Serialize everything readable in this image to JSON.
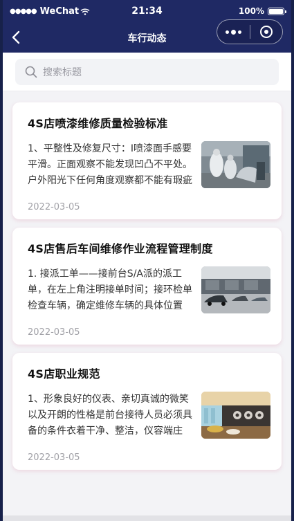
{
  "status_bar": {
    "carrier": "WeChat",
    "time": "21:34",
    "battery": "100%"
  },
  "nav": {
    "title": "车行动态"
  },
  "search": {
    "placeholder": "搜索标题"
  },
  "articles": [
    {
      "title": "4S店喷漆维修质量检验标准",
      "excerpt": "1、平整性及修复尺寸：Ⅰ喷漆面手感要平滑。正面观察不能发现凹凸不平处。户外阳光下任何角度观察都不能有瑕疵",
      "date": "2022-03-05",
      "thumb_icon": "paint-workshop-photo"
    },
    {
      "title": "4S店售后车间维修作业流程管理制度",
      "excerpt": "1. 接派工单——接前台S/A派的派工单，在左上角注明接单时间；接环检单检查车辆，确定维修车辆的具体位置",
      "date": "2022-03-05",
      "thumb_icon": "service-workshop-photo"
    },
    {
      "title": "4S店职业规范",
      "excerpt": "1、形象良好的仪表、亲切真诚的微笑以及开朗的性格是前台接待人员必须具备的条件衣着干净、整洁，仪容端庄",
      "date": "2022-03-05",
      "thumb_icon": "showroom-photo"
    }
  ]
}
